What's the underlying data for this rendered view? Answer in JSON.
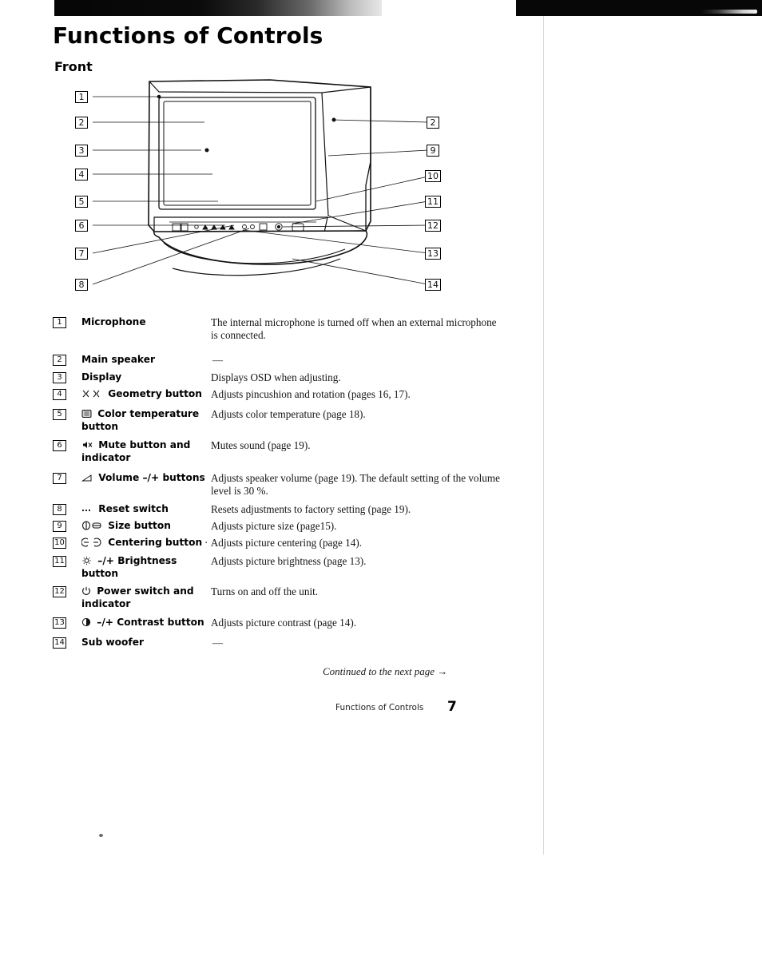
{
  "document": {
    "title": "Functions of Controls",
    "subtitle": "Front",
    "continued_note": "Continued to the next page →",
    "footer_text": "Functions of Controls",
    "page_number": "7"
  },
  "figure": {
    "name": "front-view-monitor-diagram",
    "left_callouts": [
      "1",
      "2",
      "3",
      "4",
      "5",
      "6",
      "7",
      "8"
    ],
    "right_callouts": [
      "2",
      "9",
      "10",
      "11",
      "12",
      "13",
      "14"
    ]
  },
  "items": [
    {
      "num": "1",
      "icon": "",
      "label": "Microphone",
      "desc": "The internal microphone is turned off when an external microphone is connected."
    },
    {
      "num": "2",
      "icon": "",
      "label": "Main speaker",
      "desc": "—"
    },
    {
      "num": "3",
      "icon": "",
      "label": "Display",
      "desc": "Displays OSD when adjusting."
    },
    {
      "num": "4",
      "icon": "geometry-icon",
      "label": "Geometry button",
      "desc": "Adjusts pincushion and rotation (pages 16, 17)."
    },
    {
      "num": "5",
      "icon": "color-temperature-icon",
      "label": "Color temperature button",
      "desc": "Adjusts color temperature (page 18)."
    },
    {
      "num": "6",
      "icon": "mute-icon",
      "label": "Mute button and indicator",
      "desc": "Mutes sound (page 19)."
    },
    {
      "num": "7",
      "icon": "volume-icon",
      "label": "Volume –/+ buttons",
      "desc": "Adjusts speaker volume (page 19). The default setting of the volume level is 30 %."
    },
    {
      "num": "8",
      "icon": "reset-icon",
      "label": "Reset switch",
      "desc": "Resets adjustments to factory setting (page 19)."
    },
    {
      "num": "9",
      "icon": "size-icon",
      "label": "Size button",
      "desc": "Adjusts picture size (page15)."
    },
    {
      "num": "10",
      "icon": "centering-icon",
      "label": "Centering button",
      "desc": "Adjusts picture centering (page 14)."
    },
    {
      "num": "11",
      "icon": "brightness-icon",
      "label": "–/+ Brightness button",
      "desc": "Adjusts picture brightness (page 13)."
    },
    {
      "num": "12",
      "icon": "power-icon",
      "label": "Power switch and indicator",
      "desc": "Turns on and off the unit."
    },
    {
      "num": "13",
      "icon": "contrast-icon",
      "label": "–/+ Contrast button",
      "desc": "Adjusts picture contrast (page 14)."
    },
    {
      "num": "14",
      "icon": "",
      "label": "Sub woofer",
      "desc": "—"
    }
  ]
}
